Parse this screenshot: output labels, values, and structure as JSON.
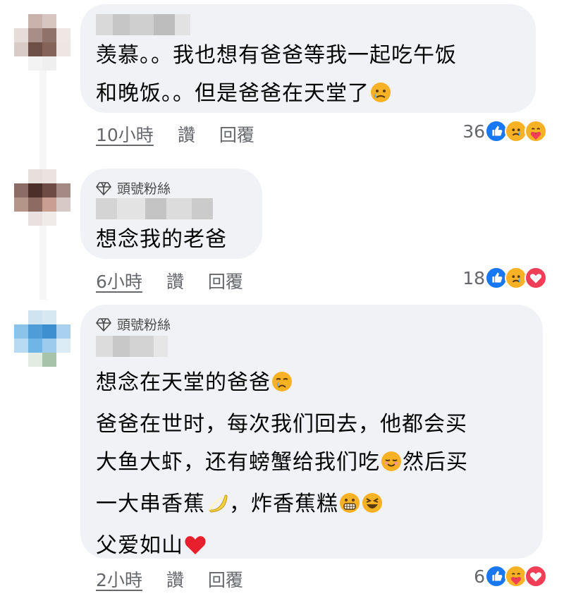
{
  "comments": [
    {
      "text_lines": [
        "羡慕。。我也想有爸爸等我一起吃午饭",
        "和晚饭。。但是爸爸在天堂了"
      ],
      "time": "10小時",
      "like_label": "讚",
      "reply_label": "回覆",
      "reaction_count": "36",
      "reactions": [
        "like-icon",
        "sad-icon",
        "care-icon"
      ]
    },
    {
      "badge": "頭號粉絲",
      "text_lines": [
        "想念我的老爸"
      ],
      "time": "6小時",
      "like_label": "讚",
      "reply_label": "回覆",
      "reaction_count": "18",
      "reactions": [
        "like-icon",
        "sad-icon",
        "love-icon"
      ]
    },
    {
      "badge": "頭號粉絲",
      "text_lines": [
        "想念在天堂的爸爸",
        "爸爸在世时，每次我们回去，他都会买",
        "大鱼大虾，还有螃蟹给我们吃",
        "然后买",
        "一大串香蕉",
        "，炸香蕉糕",
        "父爱如山"
      ],
      "time": "2小時",
      "like_label": "讚",
      "reply_label": "回覆",
      "reaction_count": "6",
      "reactions": [
        "like-icon",
        "care-icon",
        "love-icon"
      ]
    }
  ],
  "colors": {
    "bubble": "#f0f2f5",
    "meta_text": "#65676b",
    "like_blue": "#1877f2",
    "love_red": "#f33e58",
    "emoji_yellow": "#f7b125"
  }
}
